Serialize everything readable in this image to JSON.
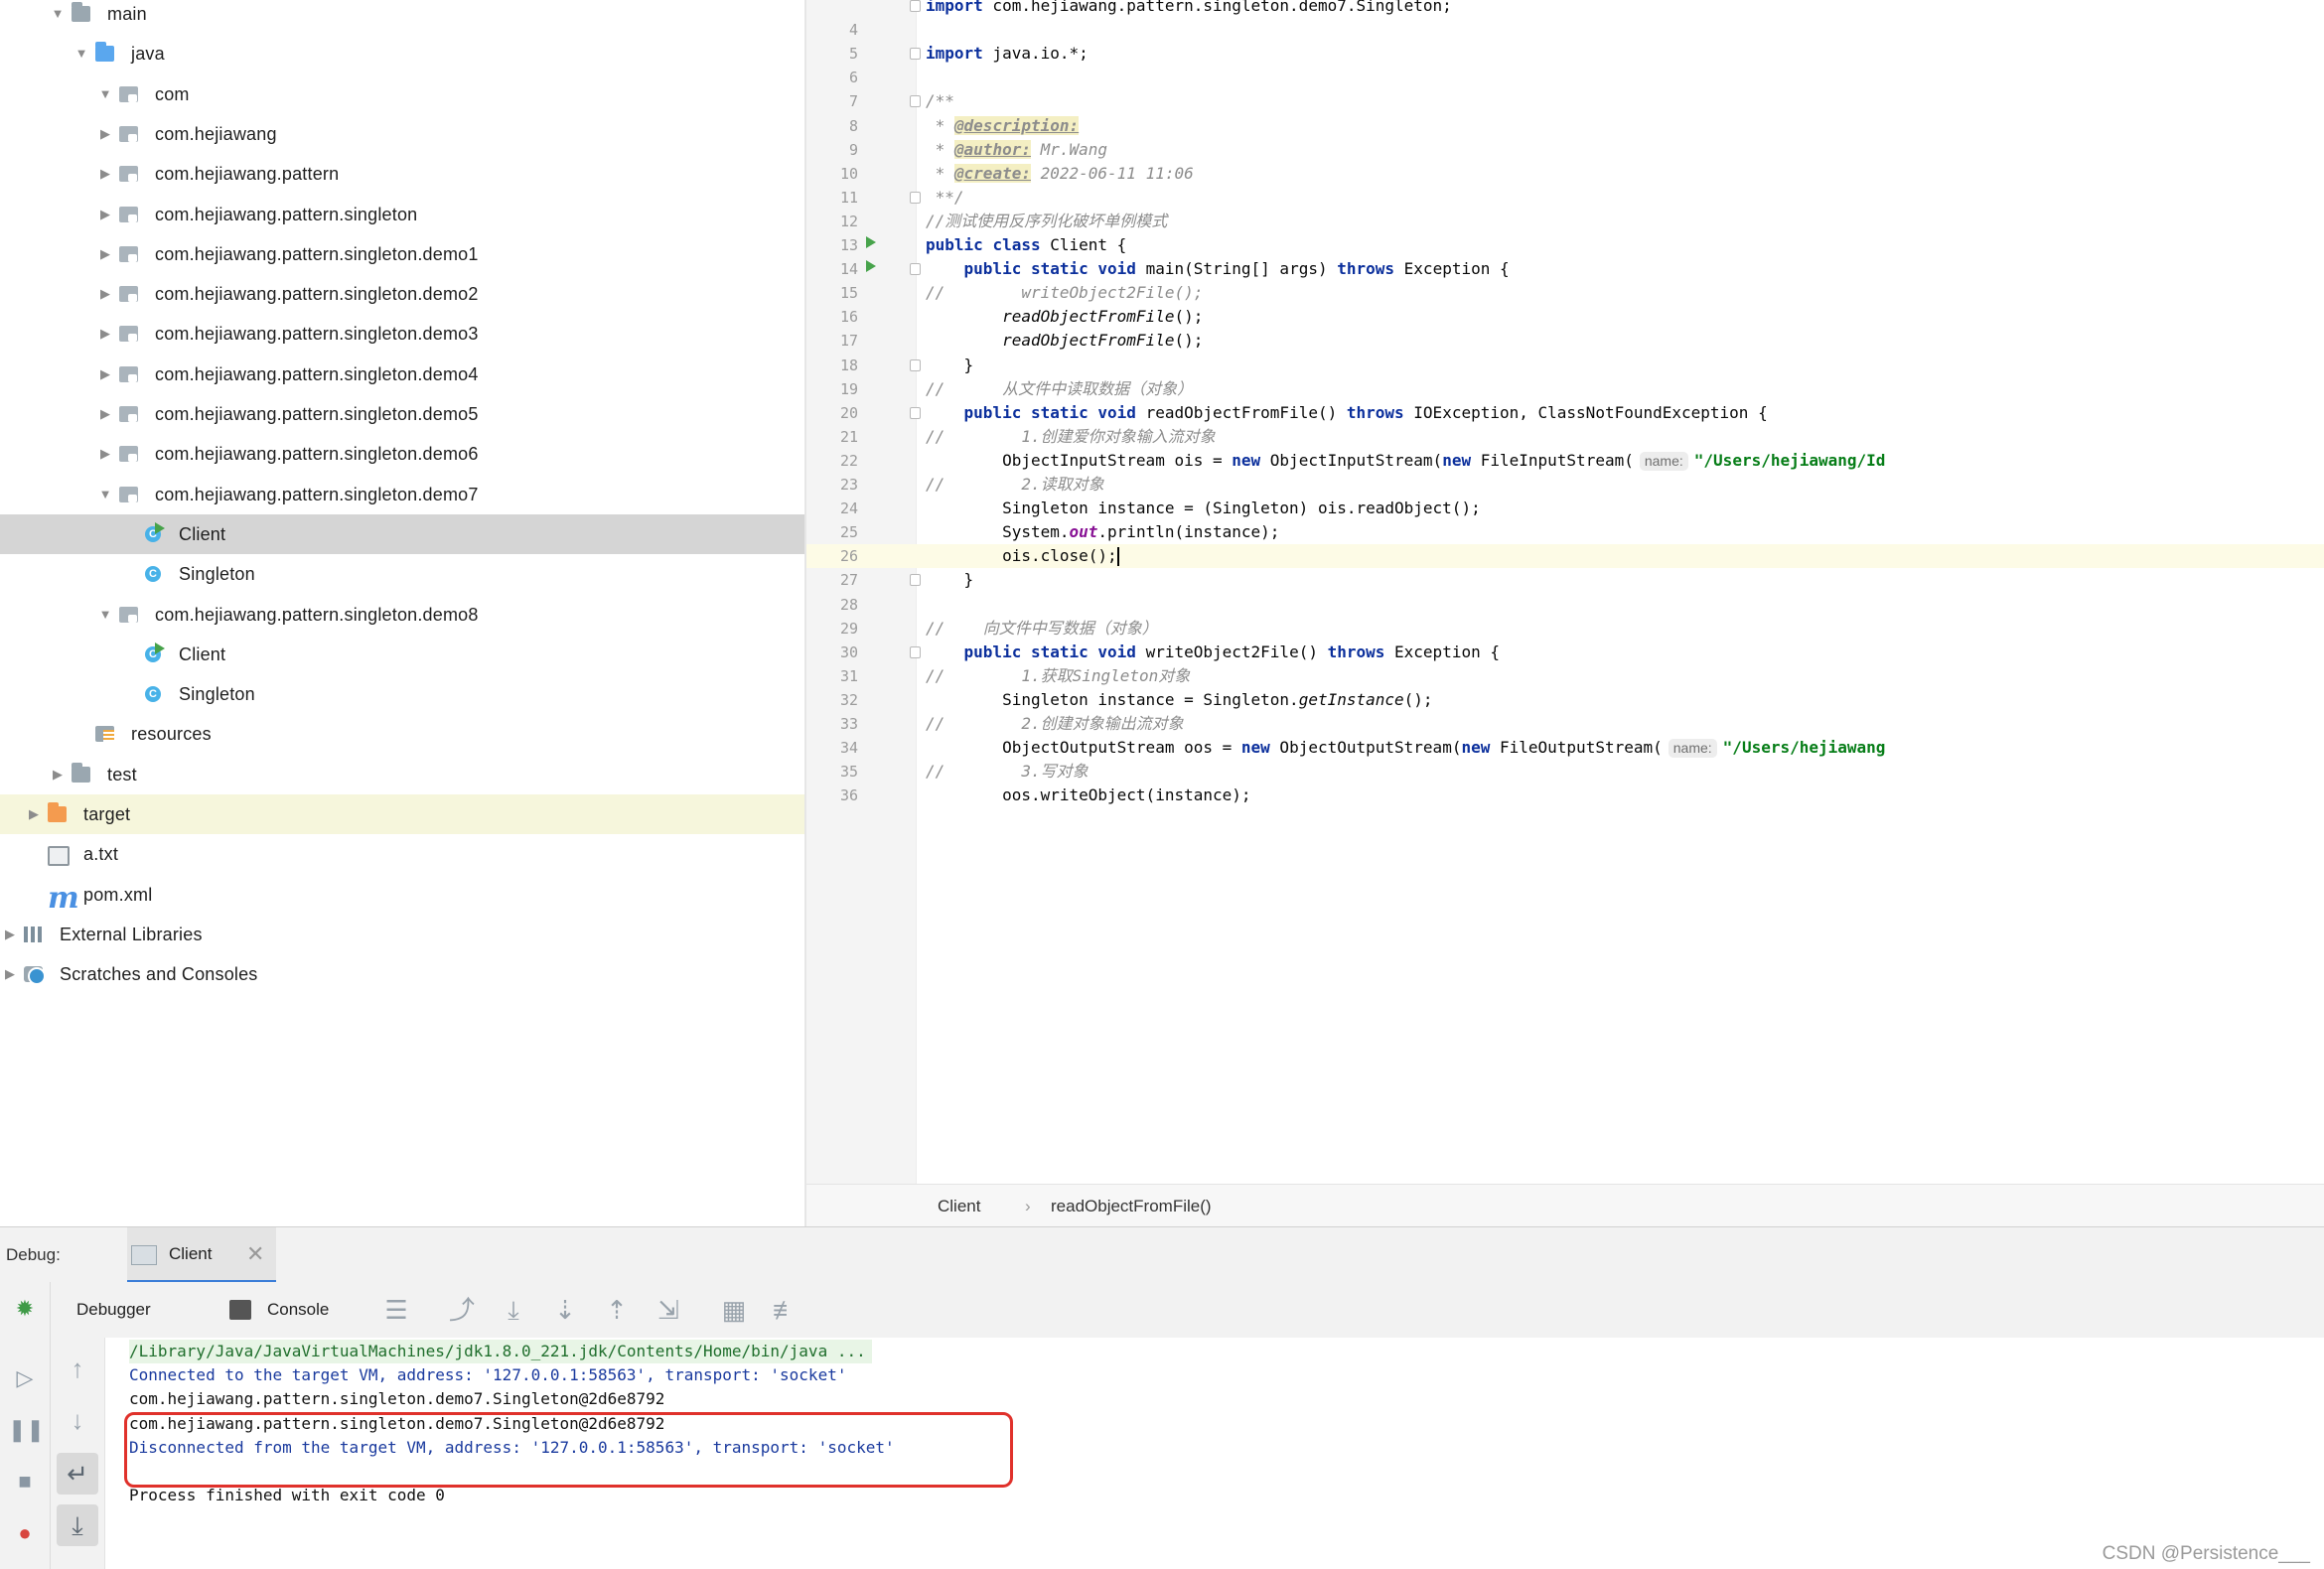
{
  "project_tree": [
    {
      "label": "main",
      "icon": "folder-icon",
      "arrow": "down",
      "indent": 1
    },
    {
      "label": "java",
      "icon": "source-folder-icon",
      "arrow": "down",
      "indent": 2
    },
    {
      "label": "com",
      "icon": "package-icon",
      "arrow": "down",
      "indent": 3
    },
    {
      "label": "com.hejiawang",
      "icon": "package-icon",
      "arrow": "right",
      "indent": 3
    },
    {
      "label": "com.hejiawang.pattern",
      "icon": "package-icon",
      "arrow": "right",
      "indent": 3
    },
    {
      "label": "com.hejiawang.pattern.singleton",
      "icon": "package-icon",
      "arrow": "right",
      "indent": 3
    },
    {
      "label": "com.hejiawang.pattern.singleton.demo1",
      "icon": "package-icon",
      "arrow": "right",
      "indent": 3
    },
    {
      "label": "com.hejiawang.pattern.singleton.demo2",
      "icon": "package-icon",
      "arrow": "right",
      "indent": 3
    },
    {
      "label": "com.hejiawang.pattern.singleton.demo3",
      "icon": "package-icon",
      "arrow": "right",
      "indent": 3
    },
    {
      "label": "com.hejiawang.pattern.singleton.demo4",
      "icon": "package-icon",
      "arrow": "right",
      "indent": 3
    },
    {
      "label": "com.hejiawang.pattern.singleton.demo5",
      "icon": "package-icon",
      "arrow": "right",
      "indent": 3
    },
    {
      "label": "com.hejiawang.pattern.singleton.demo6",
      "icon": "package-icon",
      "arrow": "right",
      "indent": 3
    },
    {
      "label": "com.hejiawang.pattern.singleton.demo7",
      "icon": "package-icon",
      "arrow": "down",
      "indent": 3
    },
    {
      "label": "Client",
      "icon": "runnable-class-icon",
      "arrow": "none",
      "indent": 4,
      "selected": true
    },
    {
      "label": "Singleton",
      "icon": "class-icon",
      "arrow": "none",
      "indent": 4
    },
    {
      "label": "com.hejiawang.pattern.singleton.demo8",
      "icon": "package-icon",
      "arrow": "down",
      "indent": 3
    },
    {
      "label": "Client",
      "icon": "runnable-class-icon",
      "arrow": "none",
      "indent": 4
    },
    {
      "label": "Singleton",
      "icon": "class-icon",
      "arrow": "none",
      "indent": 4
    },
    {
      "label": "resources",
      "icon": "resources-folder-icon",
      "arrow": "none",
      "indent": 2
    },
    {
      "label": "test",
      "icon": "folder-icon",
      "arrow": "right",
      "indent": 1
    },
    {
      "label": "target",
      "icon": "excluded-folder-icon",
      "arrow": "right",
      "indent": 0,
      "highlight": true
    },
    {
      "label": "a.txt",
      "icon": "text-file-icon",
      "arrow": "none",
      "indent": 0
    },
    {
      "label": "pom.xml",
      "icon": "maven-icon",
      "arrow": "none",
      "indent": 0
    },
    {
      "label": "External Libraries",
      "icon": "libraries-icon",
      "arrow": "right",
      "indent": -1
    },
    {
      "label": "Scratches and Consoles",
      "icon": "scratches-icon",
      "arrow": "right",
      "indent": -1
    }
  ],
  "editor": {
    "lines": [
      {
        "n": "",
        "t": "import com.hejiawang.pattern.singleton.demo7.Singleton;"
      },
      {
        "n": "4",
        "t": ""
      },
      {
        "n": "5",
        "t": "import java.io.*;"
      },
      {
        "n": "6",
        "t": ""
      },
      {
        "n": "7",
        "t": "/**"
      },
      {
        "n": "8",
        "t": " * @description:"
      },
      {
        "n": "9",
        "t": " * @author: Mr.Wang"
      },
      {
        "n": "10",
        "t": " * @create: 2022-06-11 11:06"
      },
      {
        "n": "11",
        "t": " **/"
      },
      {
        "n": "12",
        "t": "//测试使用反序列化破坏单例模式"
      },
      {
        "n": "13",
        "t": "public class Client {"
      },
      {
        "n": "14",
        "t": "    public static void main(String[] args) throws Exception {"
      },
      {
        "n": "15",
        "t": "//        writeObject2File();"
      },
      {
        "n": "16",
        "t": "        readObjectFromFile();"
      },
      {
        "n": "17",
        "t": "        readObjectFromFile();"
      },
      {
        "n": "18",
        "t": "    }"
      },
      {
        "n": "19",
        "t": "//      从文件中读取数据（对象）"
      },
      {
        "n": "20",
        "t": "    public static void readObjectFromFile() throws IOException, ClassNotFoundException {"
      },
      {
        "n": "21",
        "t": "//        1.创建爱你对象输入流对象"
      },
      {
        "n": "22",
        "t": "        ObjectInputStream ois = new ObjectInputStream(new FileInputStream( name: \"/Users/hejiawang/Id"
      },
      {
        "n": "23",
        "t": "//        2.读取对象"
      },
      {
        "n": "24",
        "t": "        Singleton instance = (Singleton) ois.readObject();"
      },
      {
        "n": "25",
        "t": "        System.out.println(instance);"
      },
      {
        "n": "26",
        "t": "        ois.close();"
      },
      {
        "n": "27",
        "t": "    }"
      },
      {
        "n": "28",
        "t": ""
      },
      {
        "n": "29",
        "t": "//    向文件中写数据（对象）"
      },
      {
        "n": "30",
        "t": "    public static void writeObject2File() throws Exception {"
      },
      {
        "n": "31",
        "t": "//        1.获取Singleton对象"
      },
      {
        "n": "32",
        "t": "        Singleton instance = Singleton.getInstance();"
      },
      {
        "n": "33",
        "t": "//        2.创建对象输出流对象"
      },
      {
        "n": "34",
        "t": "        ObjectOutputStream oos = new ObjectOutputStream(new FileOutputStream( name: \"/Users/hejiawang"
      },
      {
        "n": "35",
        "t": "//        3.写对象"
      },
      {
        "n": "36",
        "t": "        oos.writeObject(instance);"
      }
    ],
    "run_gutter_lines": [
      "13",
      "14"
    ],
    "fold_lines": [
      "3",
      "5",
      "7",
      "11",
      "14",
      "18",
      "20",
      "27",
      "30"
    ],
    "current_line": "26"
  },
  "breadcrumb": {
    "class": "Client",
    "separator": "›",
    "method": "readObjectFromFile()"
  },
  "debug": {
    "title": "Debug:",
    "run_tab": "Client",
    "tabs": {
      "debugger": "Debugger",
      "console": "Console"
    },
    "console_lines": [
      {
        "text": "/Library/Java/JavaVirtualMachines/jdk1.8.0_221.jdk/Contents/Home/bin/java ...",
        "kind": "cmd"
      },
      {
        "text": "Connected to the target VM, address: '127.0.0.1:58563', transport: 'socket'",
        "kind": "sys"
      },
      {
        "text": "com.hejiawang.pattern.singleton.demo7.Singleton@2d6e8792",
        "kind": "out"
      },
      {
        "text": "com.hejiawang.pattern.singleton.demo7.Singleton@2d6e8792",
        "kind": "out"
      },
      {
        "text": "Disconnected from the target VM, address: '127.0.0.1:58563', transport: 'socket'",
        "kind": "sys"
      },
      {
        "text": "",
        "kind": "out"
      },
      {
        "text": "Process finished with exit code 0",
        "kind": "out"
      }
    ]
  },
  "watermark": "CSDN @Persistence___",
  "colors": {
    "keyword": "#0b2f9c",
    "string": "#067d17",
    "comment": "#8c8c8c",
    "field": "#871094",
    "highlight_box": "#e0312b",
    "selection": "#d5d5d5"
  }
}
